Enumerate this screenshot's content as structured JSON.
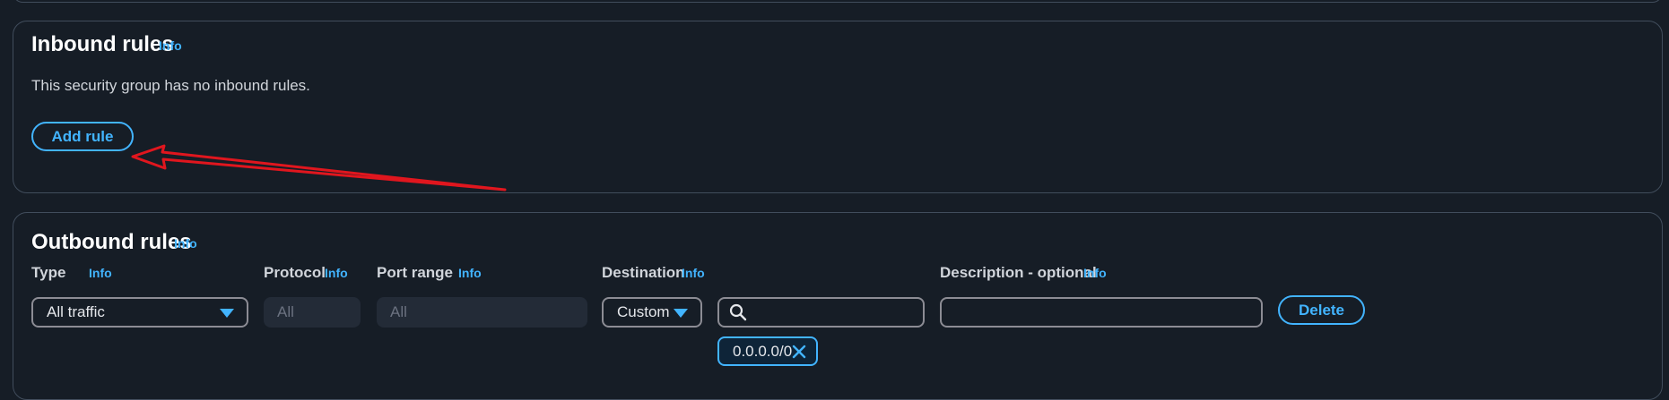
{
  "inbound": {
    "title": "Inbound rules",
    "info": "Info",
    "empty_message": "This security group has no inbound rules.",
    "add_rule_label": "Add rule"
  },
  "outbound": {
    "title": "Outbound rules",
    "info": "Info",
    "columns": {
      "type": "Type",
      "protocol": "Protocol",
      "port_range": "Port range",
      "destination": "Destination",
      "description": "Description - optional"
    },
    "column_info": "Info",
    "row": {
      "type_value": "All traffic",
      "protocol_value": "All",
      "port_range_value": "All",
      "destination_value": "Custom",
      "search_value": "",
      "cidr_token": "0.0.0.0/0",
      "description_value": "",
      "delete_label": "Delete"
    }
  },
  "colors": {
    "accent": "#42b4ff",
    "background": "#161d26",
    "annotation_arrow": "#e0161e"
  },
  "icons": [
    "search-icon",
    "close-icon",
    "caret-down-icon",
    "arrow-annotation"
  ]
}
